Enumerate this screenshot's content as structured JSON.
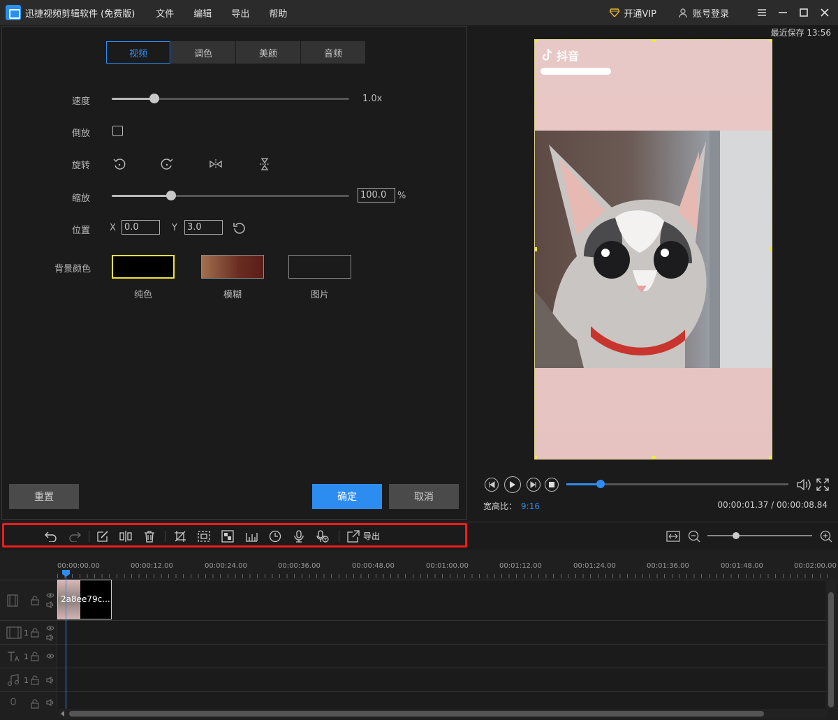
{
  "titlebar": {
    "app_title": "迅捷视频剪辑软件 (免费版)",
    "menu": [
      "文件",
      "编辑",
      "导出",
      "帮助"
    ],
    "vip_label": "开通VIP",
    "account_label": "账号登录"
  },
  "editor": {
    "tabs": [
      {
        "label": "视频",
        "active": true
      },
      {
        "label": "调色",
        "active": false
      },
      {
        "label": "美颜",
        "active": false
      },
      {
        "label": "音频",
        "active": false
      }
    ],
    "speed": {
      "label": "速度",
      "value_text": "1.0x",
      "level": 0.18
    },
    "reverse": {
      "label": "倒放",
      "checked": false
    },
    "rotate": {
      "label": "旋转",
      "icons": [
        "rotate-left-icon",
        "rotate-right-icon",
        "flip-horizontal-icon",
        "flip-vertical-icon"
      ]
    },
    "scale": {
      "label": "缩放",
      "value": "100.0",
      "unit": "%",
      "level": 0.25
    },
    "position": {
      "label": "位置",
      "x_label": "X",
      "x_value": "0.0",
      "y_label": "Y",
      "y_value": "3.0"
    },
    "background": {
      "label": "背景颜色",
      "options": [
        {
          "caption": "纯色",
          "selected": true
        },
        {
          "caption": "模糊",
          "selected": false
        },
        {
          "caption": "图片",
          "selected": false
        }
      ]
    },
    "reset_label": "重置",
    "confirm_label": "确定",
    "cancel_label": "取消"
  },
  "preview": {
    "save_status": "最近保存 13:56",
    "watermark_text": "抖音",
    "aspect_label": "宽高比：",
    "aspect_value": "9:16",
    "time_display": "00:00:01.37 / 00:00:08.84",
    "progress": 0.155
  },
  "toolbar": {
    "export_label": "导出",
    "zoom_level": 0.27
  },
  "timeline": {
    "ruler": [
      "00:00:00.00",
      "00:00:12.00",
      "00:00:24.00",
      "00:00:36.00",
      "00:00:48.00",
      "00:01:00.00",
      "00:01:12.00",
      "00:01:24.00",
      "00:01:36.00",
      "00:01:48.00",
      "00:02:00.00"
    ],
    "clip_name": "2a8ee79c...",
    "track_numbers": [
      "1",
      "1",
      "1"
    ]
  },
  "colors": {
    "accent": "#2d8cf0",
    "highlight": "#ee1c1c",
    "selected_swatch": "#f2e23a"
  }
}
